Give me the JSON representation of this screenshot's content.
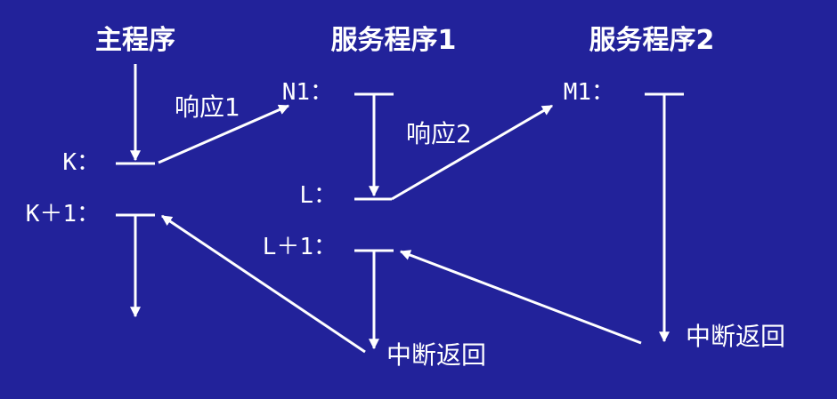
{
  "headers": {
    "main": "主程序",
    "service1": "服务程序1",
    "service2": "服务程序2"
  },
  "labels": {
    "k": "K：",
    "k_plus_1": "K＋1：",
    "n1": "N1：",
    "l": "L：",
    "l_plus_1": "L＋1：",
    "m1": "M1："
  },
  "arrow_texts": {
    "response1": "响应1",
    "response2": "响应2",
    "return_left": "中断返回",
    "return_right": "中断返回"
  },
  "colors": {
    "background": "#22229a",
    "foreground": "#ffffff"
  }
}
